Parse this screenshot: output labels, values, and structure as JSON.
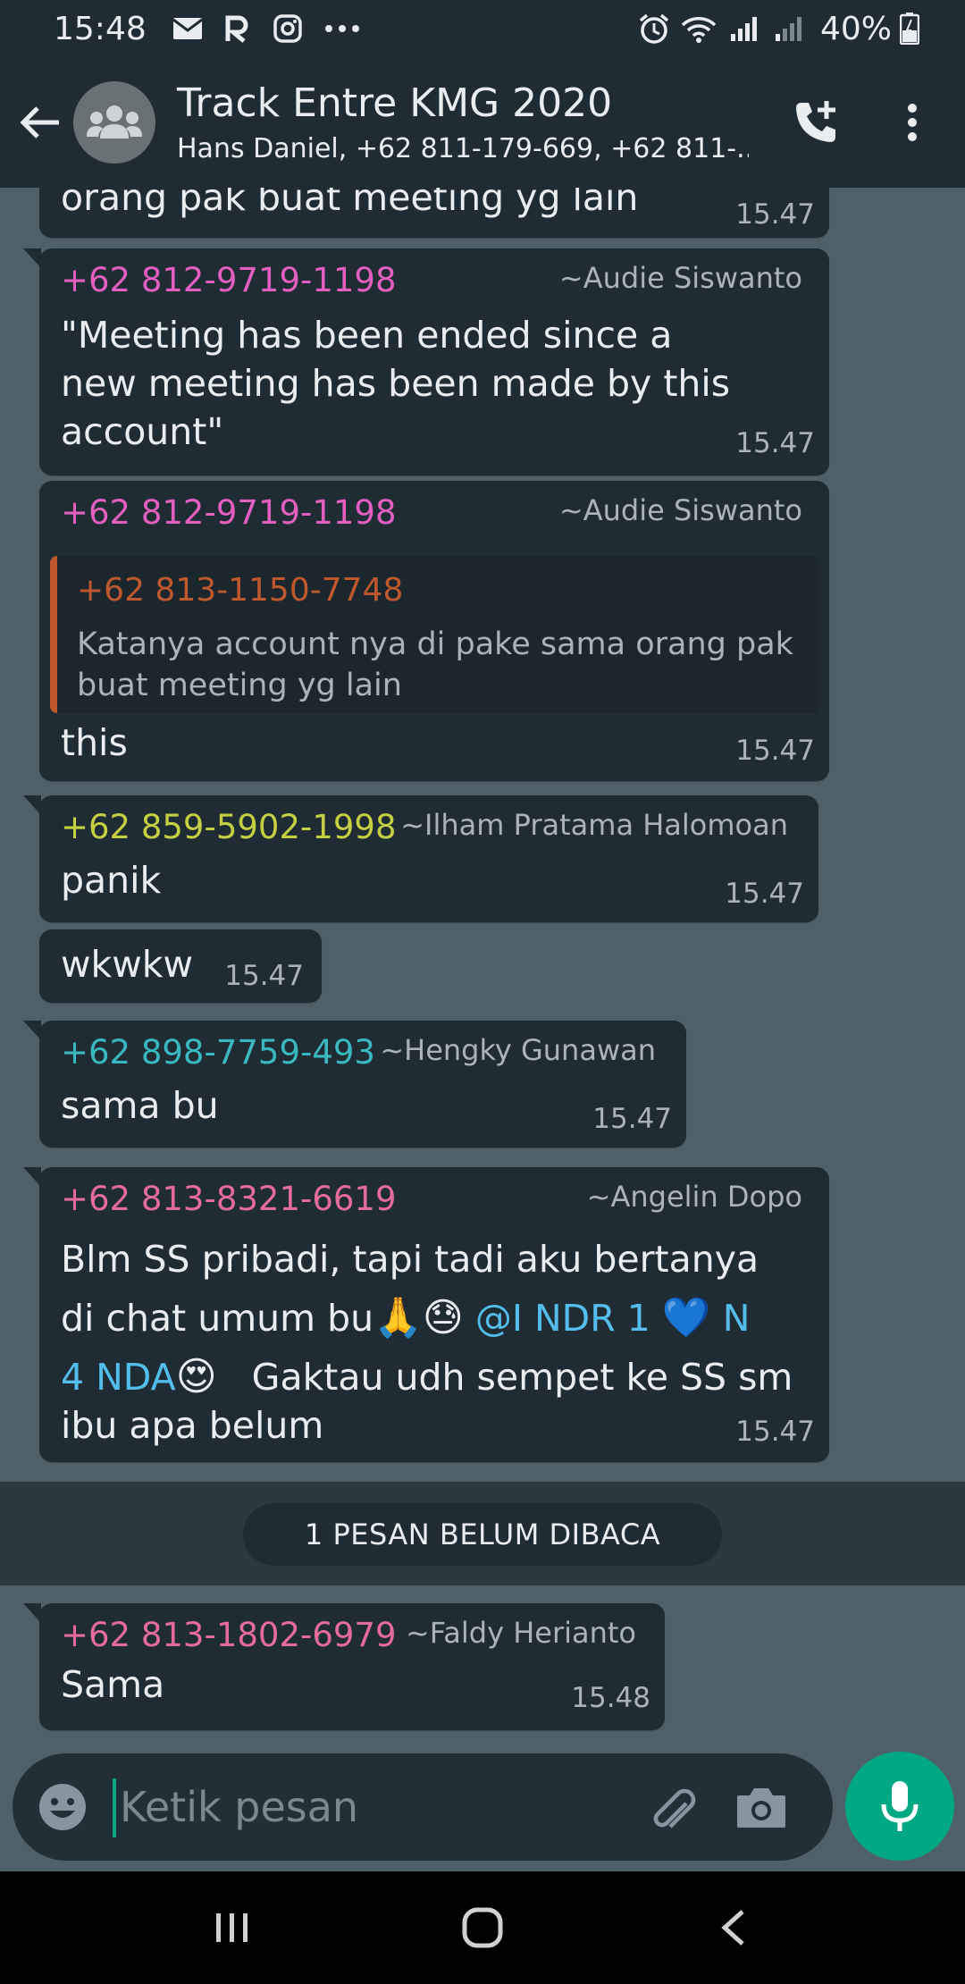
{
  "status_bar": {
    "time": "15:48",
    "battery": "40%",
    "notification_icons": [
      "mail-icon",
      "app-icon",
      "instagram-icon",
      "more-icon"
    ],
    "system_icons": [
      "alarm-icon",
      "wifi-icon",
      "signal-icon",
      "signal-icon",
      "battery-icon"
    ]
  },
  "header": {
    "title": "Track Entre KMG 2020",
    "subtitle": "Hans Daniel, +62 811-179-669, +62 811-...",
    "icons": [
      "back-arrow-icon",
      "group-avatar-icon",
      "add-call-icon",
      "more-vertical-icon"
    ]
  },
  "messages": [
    {
      "text": "orang pak buat meeting yg lain",
      "time": "15.47"
    },
    {
      "sender": "+62 812-9719-1198",
      "sender_color": "#e25fc0",
      "alias": "~Audie Siswanto",
      "lines": [
        "\"Meeting has been ended since a",
        "new meeting has been made by this",
        "account\""
      ],
      "time": "15.47"
    },
    {
      "sender": "+62 812-9719-1198",
      "sender_color": "#e25fc0",
      "alias": "~Audie Siswanto",
      "quote": {
        "sender": "+62 813-1150-7748",
        "sender_color": "#c0582e",
        "lines": [
          "Katanya account nya di pake sama orang pak",
          "buat meeting yg lain"
        ]
      },
      "text": "this",
      "time": "15.47"
    },
    {
      "sender": "+62 859-5902-1998",
      "sender_color": "#c4d042",
      "alias": "~Ilham Pratama Halomoan",
      "text": "panik",
      "time": "15.47"
    },
    {
      "text": "wkwkw",
      "time": "15.47"
    },
    {
      "sender": "+62 898-7759-493",
      "sender_color": "#3ab8c0",
      "alias": "~Hengky Gunawan",
      "text": "sama bu",
      "time": "15.47"
    },
    {
      "sender": "+62 813-8321-6619",
      "sender_color": "#e56c9a",
      "alias": "~Angelin Dopo",
      "line1": "Blm SS pribadi, tapi tadi aku bertanya",
      "line2_text": "di chat umum bu",
      "emoji_pray": "🙏",
      "emoji_sweat": "😓",
      "mention_part1": "@I NDR 1",
      "emoji_heart": "💙",
      "mention_n": "N",
      "mention_part2": "4 NDA",
      "emoji_hearteyes": "😍",
      "line3_rest": "Gaktau udh sempet ke SS sm",
      "line4": "ibu apa belum",
      "time": "15.47"
    },
    {
      "sender": "+62 813-1802-6979",
      "sender_color": "#e56c9a",
      "alias": "~Faldy Herianto",
      "text": "Sama",
      "time": "15.48"
    }
  ],
  "unread_banner": "1 PESAN BELUM DIBACA",
  "input": {
    "placeholder": "Ketik pesan",
    "value": "",
    "icons": [
      "emoji-icon",
      "attach-icon",
      "camera-icon",
      "mic-icon"
    ]
  },
  "nav": {
    "icons": [
      "recents-icon",
      "home-icon",
      "back-icon"
    ]
  },
  "colors": {
    "header_bg": "#1f2c34",
    "chat_bg": "#4e6168",
    "bubble_bg": "#1f2c33",
    "accent": "#00a884",
    "mention": "#53bdeb"
  }
}
